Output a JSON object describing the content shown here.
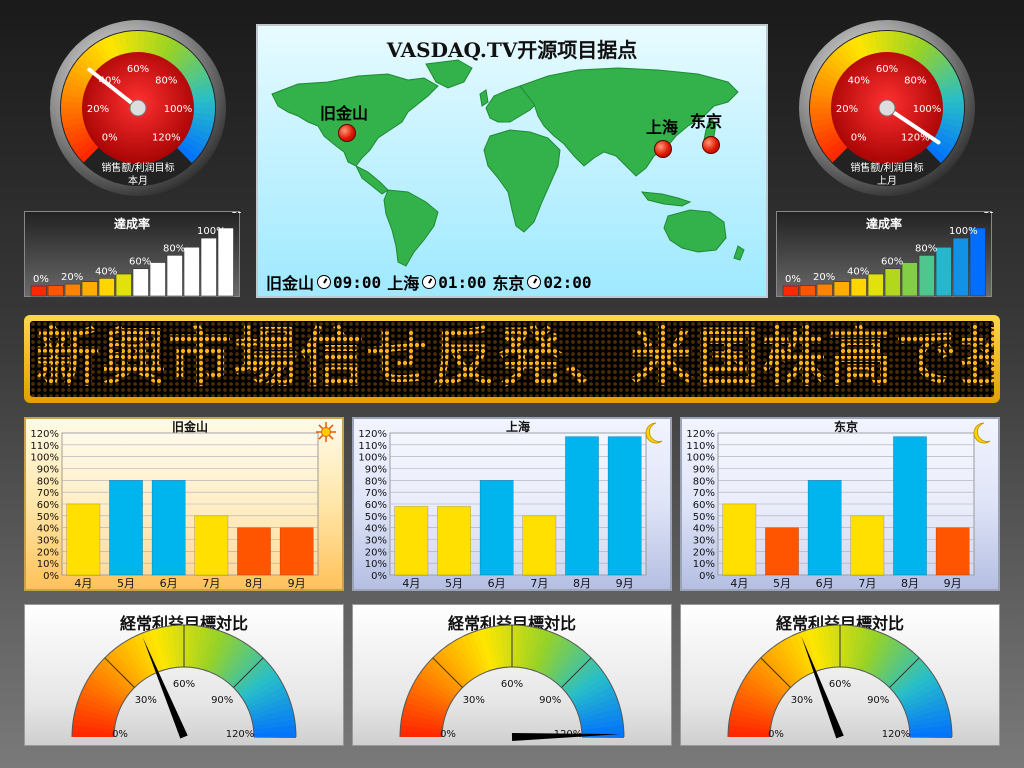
{
  "colors": {
    "needle_white": "#ffffff",
    "needle_black": "#000000",
    "sky": "#aef0ff",
    "land": "#33b14a",
    "led": "#ffb21a",
    "bar_yellow": "#ffe000",
    "bar_blue": "#00b4ee",
    "bar_orange": "#ff5500"
  },
  "round_gauges": [
    {
      "id": "this-month",
      "scale_labels": [
        "0%",
        "20%",
        "40%",
        "60%",
        "80%",
        "100%",
        "120%"
      ],
      "label_line1": "销售额/利润目标",
      "label_line2": "本月",
      "value_percent": 37
    },
    {
      "id": "last-month",
      "scale_labels": [
        "0%",
        "20%",
        "40%",
        "60%",
        "80%",
        "100%",
        "120%"
      ],
      "label_line1": "销售额/利润目标",
      "label_line2": "上月",
      "value_percent": 115
    }
  ],
  "achievement": [
    {
      "title": "達成率",
      "labels": [
        "0%",
        "20%",
        "40%",
        "60%",
        "80%",
        "100%",
        "120%"
      ],
      "level_percent": 60
    },
    {
      "title": "達成率",
      "labels": [
        "0%",
        "20%",
        "40%",
        "60%",
        "80%",
        "100%",
        "120%"
      ],
      "level_percent": 120
    }
  ],
  "map": {
    "title": "VASDAQ.TV开源项目据点",
    "cities": [
      {
        "name": "旧金山",
        "time": "09:00"
      },
      {
        "name": "上海",
        "time": "01:00"
      },
      {
        "name": "东京",
        "time": "02:00"
      }
    ]
  },
  "ticker": {
    "text": "新興市場信せ反発、米国株高で投"
  },
  "bar_charts": [
    {
      "city": "旧金山",
      "icon": "sun-icon",
      "categories": [
        "4月",
        "5月",
        "6月",
        "7月",
        "8月",
        "9月"
      ],
      "values": [
        60,
        80,
        80,
        50,
        40,
        40
      ],
      "colors": [
        "#ffe000",
        "#00b4ee",
        "#00b4ee",
        "#ffe000",
        "#ff5500",
        "#ff5500"
      ],
      "y_ticks": [
        "0%",
        "10%",
        "20%",
        "30%",
        "40%",
        "50%",
        "60%",
        "70%",
        "80%",
        "90%",
        "100%",
        "110%",
        "120%"
      ]
    },
    {
      "city": "上海",
      "icon": "moon-icon",
      "categories": [
        "4月",
        "5月",
        "6月",
        "7月",
        "8月",
        "9月"
      ],
      "values": [
        58,
        58,
        80,
        50,
        117,
        117
      ],
      "colors": [
        "#ffe000",
        "#ffe000",
        "#00b4ee",
        "#ffe000",
        "#00b4ee",
        "#00b4ee"
      ],
      "y_ticks": [
        "0%",
        "10%",
        "20%",
        "30%",
        "40%",
        "50%",
        "60%",
        "70%",
        "80%",
        "90%",
        "100%",
        "110%",
        "120%"
      ]
    },
    {
      "city": "东京",
      "icon": "moon-icon",
      "categories": [
        "4月",
        "5月",
        "6月",
        "7月",
        "8月",
        "9月"
      ],
      "values": [
        60,
        40,
        80,
        50,
        117,
        40
      ],
      "colors": [
        "#ffe000",
        "#ff5500",
        "#00b4ee",
        "#ffe000",
        "#00b4ee",
        "#ff5500"
      ],
      "y_ticks": [
        "0%",
        "10%",
        "20%",
        "30%",
        "40%",
        "50%",
        "60%",
        "70%",
        "80%",
        "90%",
        "100%",
        "110%",
        "120%"
      ]
    }
  ],
  "semi_gauges": [
    {
      "title": "経常利益目標対比",
      "labels": [
        "0%",
        "30%",
        "60%",
        "90%",
        "120%"
      ],
      "value_percent": 45
    },
    {
      "title": "経常利益目標対比",
      "labels": [
        "0%",
        "30%",
        "60%",
        "90%",
        "120%"
      ],
      "value_percent": 119
    },
    {
      "title": "経常利益目標対比",
      "labels": [
        "0%",
        "30%",
        "60%",
        "90%",
        "120%"
      ],
      "value_percent": 46
    }
  ]
}
